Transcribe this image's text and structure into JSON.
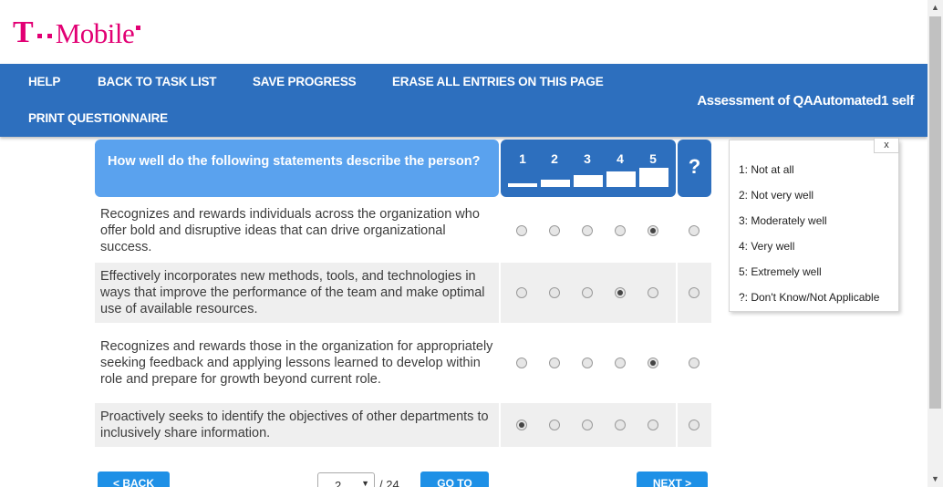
{
  "brand": {
    "name": "Mobile",
    "t": "T"
  },
  "nav": {
    "help": "HELP",
    "back": "BACK TO TASK LIST",
    "save": "SAVE PROGRESS",
    "erase": "ERASE ALL ENTRIES ON THIS PAGE",
    "print": "PRINT QUESTIONNAIRE",
    "assessment": "Assessment of QAAutomated1 self"
  },
  "question": {
    "prompt": "How well do the following statements describe the person?",
    "scale": [
      "1",
      "2",
      "3",
      "4",
      "5"
    ],
    "unknown": "?"
  },
  "rows": [
    {
      "text": "Recognizes and rewards individuals across the organization who offer bold and disruptive ideas that can drive organizational success.",
      "selected": "5"
    },
    {
      "text": "Effectively incorporates new methods, tools, and technologies in ways that improve the performance of the team and make optimal use of available resources.",
      "selected": "4"
    },
    {
      "text": "Recognizes and rewards those in the organization for appropriately seeking feedback and applying lessons learned to develop within role and prepare for growth beyond current role.",
      "selected": "5"
    },
    {
      "text": "Proactively seeks to identify the objectives of other departments to inclusively share information.",
      "selected": "1"
    }
  ],
  "legend": {
    "close": "x",
    "items": [
      "1: Not at all",
      "2: Not very well",
      "3: Moderately well",
      "4: Very well",
      "5: Extremely well",
      "?: Don't Know/Not Applicable"
    ]
  },
  "footer": {
    "back": "< BACK",
    "page": "2",
    "total": "/ 24",
    "goto": "GO TO",
    "next": "NEXT >"
  },
  "colors": {
    "brand": "#e20074",
    "nav": "#2d6fbe",
    "header_light": "#5aa2ee",
    "button": "#1e90e6"
  }
}
